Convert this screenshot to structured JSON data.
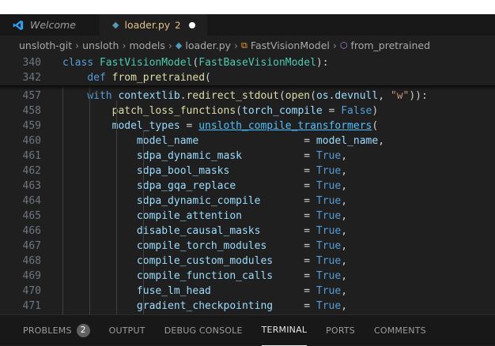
{
  "tabs": [
    {
      "label": "Welcome",
      "icon": "vscode-logo-icon"
    },
    {
      "label": "loader.py",
      "count": "2",
      "icon": "python-file-icon"
    }
  ],
  "breadcrumb": [
    "unsloth-git",
    "unsloth",
    "models",
    "loader.py",
    "FastVisionModel",
    "from_pretrained"
  ],
  "sticky": [
    {
      "num": "340",
      "tokens": [
        [
          "kw",
          "class "
        ],
        [
          "cls",
          "FastVisionModel"
        ],
        [
          "p",
          "("
        ],
        [
          "cls",
          "FastBaseVisionModel"
        ],
        [
          "p",
          "):"
        ]
      ]
    },
    {
      "num": "342",
      "tokens": [
        [
          "p",
          "    "
        ],
        [
          "kw",
          "def "
        ],
        [
          "fn",
          "from_pretrained"
        ],
        [
          "p",
          "("
        ]
      ]
    }
  ],
  "lines": [
    {
      "num": "457",
      "tokens": [
        [
          "p",
          "    "
        ],
        [
          "kw",
          "with "
        ],
        [
          "var",
          "contextlib"
        ],
        [
          "p",
          "."
        ],
        [
          "fn",
          "redirect_stdout"
        ],
        [
          "p",
          "("
        ],
        [
          "fn",
          "open"
        ],
        [
          "p",
          "("
        ],
        [
          "var",
          "os"
        ],
        [
          "p",
          "."
        ],
        [
          "var",
          "devnull"
        ],
        [
          "p",
          ", "
        ],
        [
          "str",
          "\"w\""
        ],
        [
          "p",
          "))"
        ],
        [
          "p",
          ":"
        ]
      ]
    },
    {
      "num": "458",
      "tokens": [
        [
          "p",
          "        "
        ],
        [
          "fn",
          "patch_loss_functions"
        ],
        [
          "p",
          "("
        ],
        [
          "var",
          "torch_compile"
        ],
        [
          "p",
          " = "
        ],
        [
          "const",
          "False"
        ],
        [
          "p",
          ")"
        ]
      ]
    },
    {
      "num": "459",
      "tokens": [
        [
          "p",
          "        "
        ],
        [
          "var",
          "model_types"
        ],
        [
          "p",
          " = "
        ],
        [
          "link",
          "unsloth_compile_transformers"
        ],
        [
          "p",
          "("
        ]
      ]
    },
    {
      "num": "460",
      "tokens": [
        [
          "p",
          "            "
        ],
        [
          "var",
          "model_name"
        ],
        [
          "p",
          "                 = "
        ],
        [
          "var",
          "model_name"
        ],
        [
          "p",
          ","
        ]
      ]
    },
    {
      "num": "461",
      "tokens": [
        [
          "p",
          "            "
        ],
        [
          "var",
          "sdpa_dynamic_mask"
        ],
        [
          "p",
          "          = "
        ],
        [
          "const",
          "True"
        ],
        [
          "p",
          ","
        ]
      ]
    },
    {
      "num": "462",
      "tokens": [
        [
          "p",
          "            "
        ],
        [
          "var",
          "sdpa_bool_masks"
        ],
        [
          "p",
          "            = "
        ],
        [
          "const",
          "True"
        ],
        [
          "p",
          ","
        ]
      ]
    },
    {
      "num": "463",
      "tokens": [
        [
          "p",
          "            "
        ],
        [
          "var",
          "sdpa_gqa_replace"
        ],
        [
          "p",
          "           = "
        ],
        [
          "const",
          "True"
        ],
        [
          "p",
          ","
        ]
      ]
    },
    {
      "num": "464",
      "tokens": [
        [
          "p",
          "            "
        ],
        [
          "var",
          "sdpa_dynamic_compile"
        ],
        [
          "p",
          "       = "
        ],
        [
          "const",
          "True"
        ],
        [
          "p",
          ","
        ]
      ]
    },
    {
      "num": "465",
      "tokens": [
        [
          "p",
          "            "
        ],
        [
          "var",
          "compile_attention"
        ],
        [
          "p",
          "          = "
        ],
        [
          "const",
          "True"
        ],
        [
          "p",
          ","
        ]
      ]
    },
    {
      "num": "466",
      "tokens": [
        [
          "p",
          "            "
        ],
        [
          "var",
          "disable_causal_masks"
        ],
        [
          "p",
          "       = "
        ],
        [
          "const",
          "True"
        ],
        [
          "p",
          ","
        ]
      ]
    },
    {
      "num": "467",
      "tokens": [
        [
          "p",
          "            "
        ],
        [
          "var",
          "compile_torch_modules"
        ],
        [
          "p",
          "      = "
        ],
        [
          "const",
          "True"
        ],
        [
          "p",
          ","
        ]
      ]
    },
    {
      "num": "468",
      "tokens": [
        [
          "p",
          "            "
        ],
        [
          "var",
          "compile_custom_modules"
        ],
        [
          "p",
          "     = "
        ],
        [
          "const",
          "True"
        ],
        [
          "p",
          ","
        ]
      ]
    },
    {
      "num": "469",
      "tokens": [
        [
          "p",
          "            "
        ],
        [
          "var",
          "compile_function_calls"
        ],
        [
          "p",
          "     = "
        ],
        [
          "const",
          "True"
        ],
        [
          "p",
          ","
        ]
      ]
    },
    {
      "num": "470",
      "tokens": [
        [
          "p",
          "            "
        ],
        [
          "var",
          "fuse_lm_head"
        ],
        [
          "p",
          "               = "
        ],
        [
          "const",
          "True"
        ],
        [
          "p",
          ","
        ]
      ]
    },
    {
      "num": "471",
      "tokens": [
        [
          "p",
          "            "
        ],
        [
          "var",
          "gradient_checkpointing"
        ],
        [
          "p",
          "     = "
        ],
        [
          "const",
          "True"
        ],
        [
          "p",
          ","
        ]
      ]
    }
  ],
  "panel_tabs": [
    {
      "label": "PROBLEMS",
      "badge": "2"
    },
    {
      "label": "OUTPUT"
    },
    {
      "label": "DEBUG CONSOLE"
    },
    {
      "label": "TERMINAL",
      "active": true
    },
    {
      "label": "PORTS"
    },
    {
      "label": "COMMENTS"
    }
  ],
  "colors": {
    "keyword": "#569cd6",
    "class": "#4ec9b0",
    "function": "#dcdcaa",
    "variable": "#9cdcfe",
    "string": "#ce9178",
    "modified_tab": "#e2c08d"
  }
}
